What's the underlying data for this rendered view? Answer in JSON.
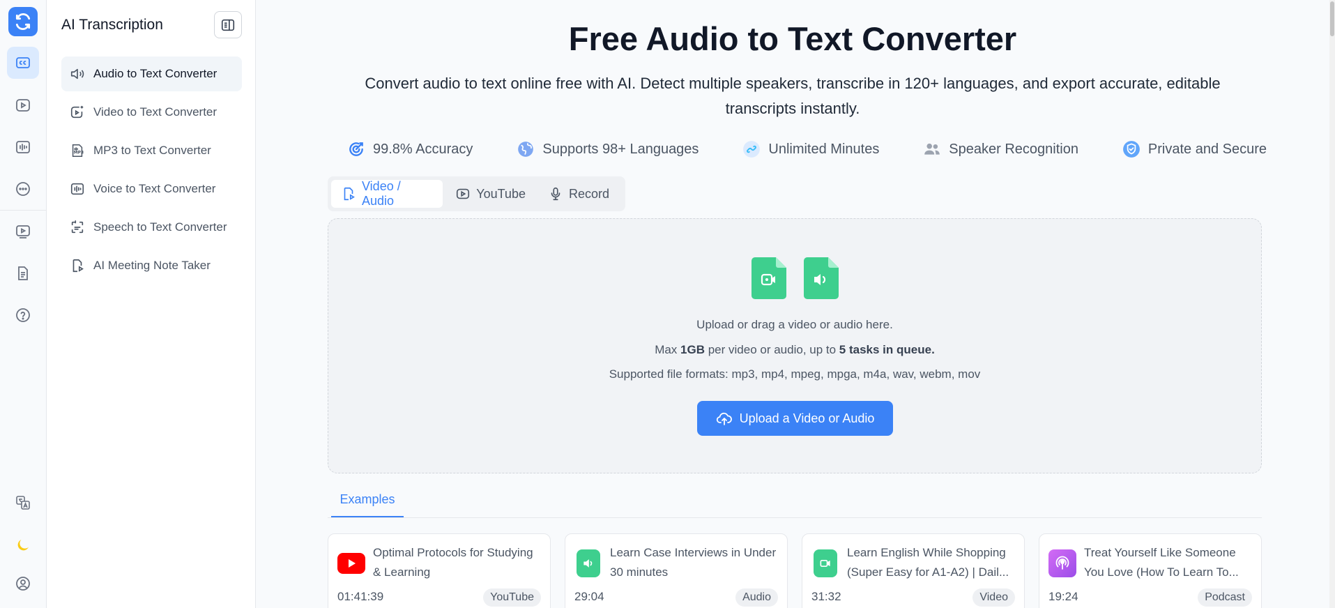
{
  "app_title": "AI Transcription",
  "sidebar": {
    "items": [
      {
        "label": "Audio to Text Converter"
      },
      {
        "label": "Video to Text Converter"
      },
      {
        "label": "MP3 to Text Converter"
      },
      {
        "label": "Voice to Text Converter"
      },
      {
        "label": "Speech to Text Converter"
      },
      {
        "label": "AI Meeting Note Taker"
      }
    ]
  },
  "main": {
    "title": "Free Audio to Text Converter",
    "subtitle": "Convert audio to text online free with AI. Detect multiple speakers, transcribe in 120+ languages, and export accurate, editable transcripts instantly.",
    "features": [
      {
        "label": "99.8% Accuracy"
      },
      {
        "label": "Supports 98+ Languages"
      },
      {
        "label": "Unlimited Minutes"
      },
      {
        "label": "Speaker Recognition"
      },
      {
        "label": "Private and Secure"
      }
    ],
    "tabs": [
      {
        "label": "Video / Audio"
      },
      {
        "label": "YouTube"
      },
      {
        "label": "Record"
      }
    ],
    "upload": {
      "line1": "Upload or drag a video or audio here.",
      "line2_prefix": "Max ",
      "line2_size": "1GB",
      "line2_mid": " per video or audio, up to ",
      "line2_tasks": "5 tasks in queue.",
      "line3": "Supported file formats: mp3, mp4, mpeg, mpga, m4a, wav, webm, mov",
      "button": "Upload a Video or Audio"
    },
    "examples_tab": "Examples",
    "examples": [
      {
        "title": "Optimal Protocols for Studying & Learning",
        "duration": "01:41:39",
        "badge": "YouTube"
      },
      {
        "title": "Learn Case Interviews in Under 30 minutes",
        "duration": "29:04",
        "badge": "Audio"
      },
      {
        "title": "Learn English While Shopping (Super Easy for A1-A2) | Dail...",
        "duration": "31:32",
        "badge": "Video"
      },
      {
        "title": "Treat Yourself Like Someone You Love (How To Learn To...",
        "duration": "19:24",
        "badge": "Podcast"
      }
    ]
  },
  "colors": {
    "accent": "#3b82f6",
    "green": "#3ecf8e",
    "youtube_red": "#ff0000",
    "podcast_purple": "#b45cf0",
    "moon_yellow": "#facc15"
  }
}
